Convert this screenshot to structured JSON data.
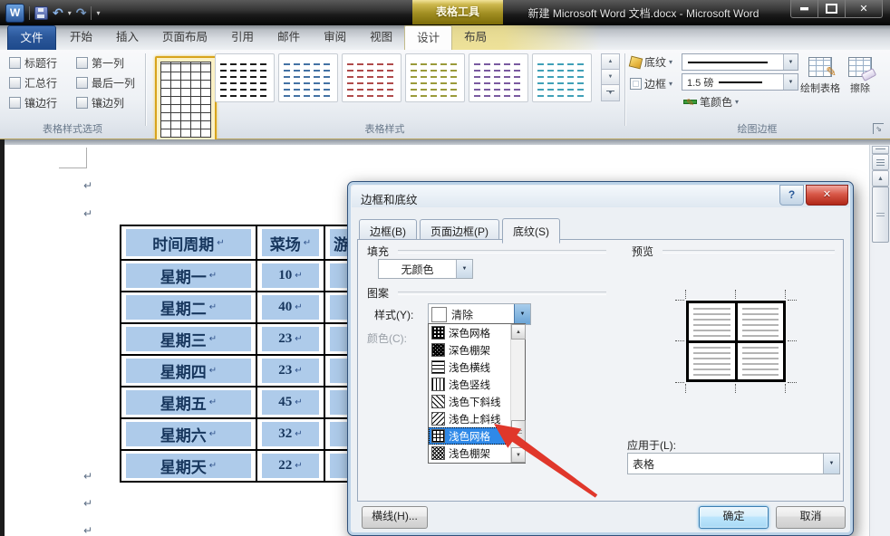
{
  "window": {
    "contextual_tool": "表格工具",
    "title": "新建 Microsoft Word 文档.docx - Microsoft Word"
  },
  "tabs": {
    "file": "文件",
    "main": [
      "开始",
      "插入",
      "页面布局",
      "引用",
      "邮件",
      "审阅",
      "视图"
    ],
    "design": "设计",
    "layout": "布局"
  },
  "ribbon": {
    "style_options": {
      "label": "表格样式选项",
      "checks": [
        "标题行",
        "第一列",
        "汇总行",
        "最后一列",
        "镶边行",
        "镶边列"
      ]
    },
    "table_styles": {
      "label": "表格样式",
      "thumbs": [
        {
          "color": "#1a1a1a"
        },
        {
          "color": "#4472a4"
        },
        {
          "color": "#b04a4a"
        },
        {
          "color": "#9a9a3a"
        },
        {
          "color": "#7a5aa0"
        },
        {
          "color": "#40a0b8"
        }
      ]
    },
    "draw_borders": {
      "label": "绘图边框",
      "shading": "底纹",
      "borders": "边框",
      "weight": "1.5 磅",
      "pen_color": "笔颜色",
      "draw_table": "绘制表格",
      "eraser": "擦除"
    }
  },
  "document": {
    "table": {
      "headers": [
        "时间周期",
        "菜场",
        "游"
      ],
      "rows": [
        [
          "星期一",
          "10"
        ],
        [
          "星期二",
          "40"
        ],
        [
          "星期三",
          "23"
        ],
        [
          "星期四",
          "23"
        ],
        [
          "星期五",
          "45"
        ],
        [
          "星期六",
          "32"
        ],
        [
          "星期天",
          "22"
        ]
      ]
    }
  },
  "dialog": {
    "title": "边框和底纹",
    "tabs": [
      "边框(B)",
      "页面边框(P)",
      "底纹(S)"
    ],
    "active_tab": "底纹(S)",
    "fill_label": "填充",
    "fill_value": "无颜色",
    "pattern_label": "图案",
    "style_label": "样式(Y):",
    "style_value": "清除",
    "color_label": "颜色(C):",
    "pattern_list": [
      {
        "label": "深色网格",
        "pattern": "dark-grid"
      },
      {
        "label": "深色棚架",
        "pattern": "dark-trellis"
      },
      {
        "label": "浅色横线",
        "pattern": "lt-horizontal"
      },
      {
        "label": "浅色竖线",
        "pattern": "lt-vertical"
      },
      {
        "label": "浅色下斜线",
        "pattern": "lt-down"
      },
      {
        "label": "浅色上斜线",
        "pattern": "lt-up"
      },
      {
        "label": "浅色网格",
        "pattern": "lt-grid"
      },
      {
        "label": "浅色棚架",
        "pattern": "lt-trellis"
      }
    ],
    "selected_pattern_index": 6,
    "preview_label": "预览",
    "apply_label": "应用于(L):",
    "apply_value": "表格",
    "horizontal_line_button": "横线(H)...",
    "ok_button": "确定",
    "cancel_button": "取消"
  },
  "icons": {
    "word": "W",
    "undo": "↶",
    "redo": "↷",
    "menu_arrow": "▾",
    "combo_arrow": "▼",
    "up_arrow": "▲",
    "down_arrow": "▼",
    "close": "✕",
    "help": "?",
    "pencil": "✎",
    "launcher": "⇘",
    "pilcrow": "↵"
  },
  "colors": {
    "selection": "#aecbea",
    "table_text": "#17365d",
    "highlight": "#2f89e8",
    "contextual_gold": "#a18e22",
    "file_tab_blue": "#2b579a",
    "arrow": "#e0372b"
  }
}
